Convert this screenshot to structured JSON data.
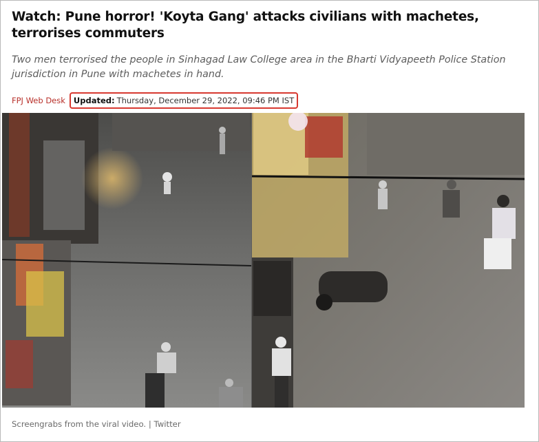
{
  "article": {
    "headline": "Watch: Pune horror! 'Koyta Gang' attacks civilians with machetes, terrorises commuters",
    "summary": "Two men terrorised the people in Sinhagad Law College area in the Bharti Vidyapeeth Police Station jurisdiction in Pune with machetes in hand.",
    "author": "FPJ Web Desk",
    "updated_label": "Updated:",
    "updated_date": "Thursday, December 29, 2022, 09:46 PM IST"
  },
  "image": {
    "caption": "Screengrabs from the viral video. | Twitter"
  },
  "colors": {
    "author_red": "#b8302a",
    "highlight_box": "#d7382f"
  }
}
